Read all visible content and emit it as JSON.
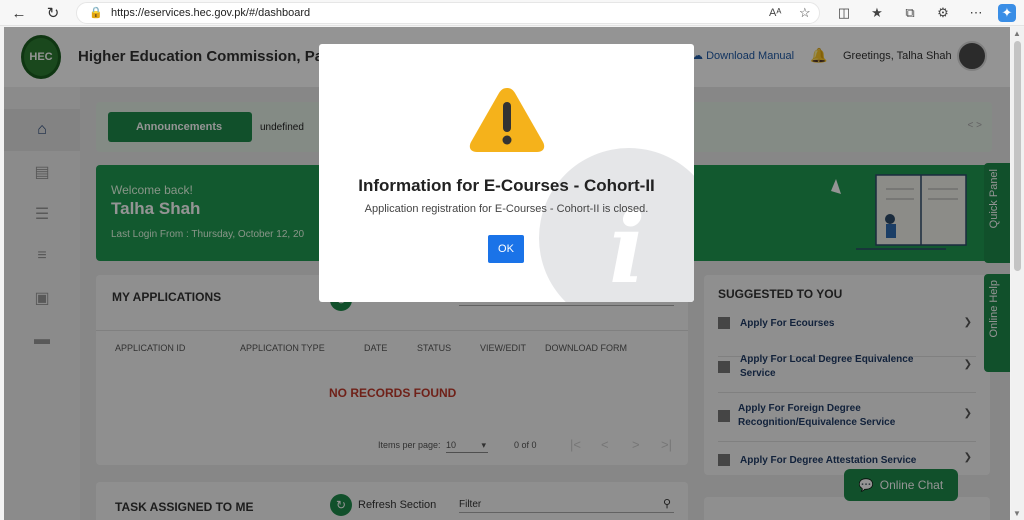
{
  "browser": {
    "url": "https://eservices.hec.gov.pk/#/dashboard",
    "read_aloud": "Aᴬ"
  },
  "header": {
    "title": "Higher Education Commission, Pa",
    "download_manual": "Download Manual",
    "greeting": "Greetings, Talha Shah"
  },
  "announcements": {
    "button_label": "Announcements",
    "text": "undefined",
    "arrows": "< >"
  },
  "welcome": {
    "label": "Welcome back!",
    "name": "Talha Shah",
    "last_login": "Last Login From : Thursday, October 12, 20"
  },
  "applications": {
    "title": "MY APPLICATIONS",
    "refresh_label": "Refresh Section",
    "columns": [
      "APPLICATION ID",
      "APPLICATION TYPE",
      "DATE",
      "STATUS",
      "VIEW/EDIT",
      "DOWNLOAD FORM"
    ],
    "empty_message": "NO RECORDS FOUND",
    "items_per_page_label": "Items per page:",
    "items_per_page_value": "10",
    "range_label": "0 of 0"
  },
  "tasks": {
    "title": "TASK ASSIGNED TO ME",
    "refresh_label": "Refresh Section",
    "filter_placeholder": "Filter"
  },
  "suggested": {
    "title": "SUGGESTED TO YOU",
    "items": [
      {
        "label": "Apply For Ecourses"
      },
      {
        "label": "Apply For Local Degree Equivalence Service"
      },
      {
        "label": "Apply For Foreign Degree Recognition/Equivalence Service"
      },
      {
        "label": "Apply For Degree Attestation Service"
      }
    ]
  },
  "side_tabs": {
    "quick_panel": "Quick Panel",
    "online_help": "Online Help"
  },
  "chat": {
    "label": "Online Chat"
  },
  "modal": {
    "title": "Information for E-Courses - Cohort-II",
    "message": "Application registration for E-Courses - Cohort-II is closed.",
    "ok_label": "OK",
    "icon": "warning-icon",
    "warning_color": "#f5b21b"
  },
  "colors": {
    "brand_green": "#1e8a4a",
    "link_blue": "#1f5aa6",
    "ok_blue": "#1a73e8",
    "error_red": "#c0392b"
  }
}
